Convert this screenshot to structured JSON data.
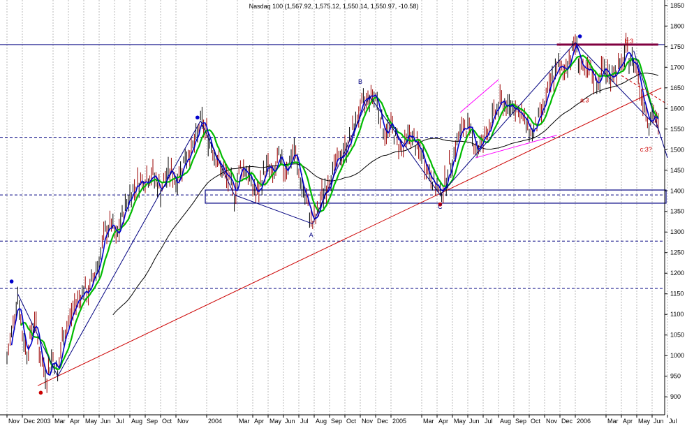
{
  "chart_data": {
    "type": "line",
    "title": "Nasdaq 100 (1,567.92, 1,575.12, 1,550.14, 1,550.97, -10.58)",
    "xlabel": "",
    "ylabel": "",
    "ylim": [
      880,
      1870
    ],
    "y_ticks": [
      900,
      950,
      1000,
      1050,
      1100,
      1150,
      1200,
      1250,
      1300,
      1350,
      1400,
      1450,
      1500,
      1550,
      1600,
      1650,
      1700,
      1750,
      1800,
      1850
    ],
    "x_ticks": [
      {
        "t": 0.0,
        "label": "Nov"
      },
      {
        "t": 1.0,
        "label": "Dec 2003"
      },
      {
        "t": 3.0,
        "label": "Mar"
      },
      {
        "t": 4.0,
        "label": "Apr"
      },
      {
        "t": 5.0,
        "label": "May"
      },
      {
        "t": 6.0,
        "label": "Jun"
      },
      {
        "t": 7.0,
        "label": "Jul"
      },
      {
        "t": 8.0,
        "label": "Aug"
      },
      {
        "t": 9.0,
        "label": "Sep"
      },
      {
        "t": 10.0,
        "label": "Oct"
      },
      {
        "t": 11.0,
        "label": "Nov"
      },
      {
        "t": 13.0,
        "label": "2004"
      },
      {
        "t": 15.0,
        "label": "Mar"
      },
      {
        "t": 16.0,
        "label": "Apr"
      },
      {
        "t": 17.0,
        "label": "May"
      },
      {
        "t": 18.0,
        "label": "Jun"
      },
      {
        "t": 19.0,
        "label": "Jul"
      },
      {
        "t": 20.0,
        "label": "Aug"
      },
      {
        "t": 21.0,
        "label": "Sep"
      },
      {
        "t": 22.0,
        "label": "Oct"
      },
      {
        "t": 23.0,
        "label": "Nov"
      },
      {
        "t": 24.0,
        "label": "Dec"
      },
      {
        "t": 25.0,
        "label": "2005"
      },
      {
        "t": 27.0,
        "label": "Mar"
      },
      {
        "t": 28.0,
        "label": "Apr"
      },
      {
        "t": 29.0,
        "label": "May"
      },
      {
        "t": 30.0,
        "label": "Jun"
      },
      {
        "t": 31.0,
        "label": "Jul"
      },
      {
        "t": 32.0,
        "label": "Aug"
      },
      {
        "t": 33.0,
        "label": "Sep"
      },
      {
        "t": 34.0,
        "label": "Oct"
      },
      {
        "t": 35.0,
        "label": "Nov"
      },
      {
        "t": 36.0,
        "label": "Dec"
      },
      {
        "t": 37.0,
        "label": "2006"
      },
      {
        "t": 39.0,
        "label": "Mar"
      },
      {
        "t": 40.0,
        "label": "Apr"
      },
      {
        "t": 41.0,
        "label": "May"
      },
      {
        "t": 42.0,
        "label": "Jun"
      },
      {
        "t": 43.0,
        "label": "Jul"
      }
    ],
    "price_path": [
      [
        0.0,
        990
      ],
      [
        0.4,
        1080
      ],
      [
        0.7,
        1150
      ],
      [
        1.0,
        1050
      ],
      [
        1.3,
        1010
      ],
      [
        1.8,
        1090
      ],
      [
        2.2,
        990
      ],
      [
        2.6,
        950
      ],
      [
        3.0,
        1000
      ],
      [
        3.3,
        950
      ],
      [
        3.6,
        1040
      ],
      [
        4.0,
        1080
      ],
      [
        4.5,
        1130
      ],
      [
        5.0,
        1160
      ],
      [
        5.3,
        1150
      ],
      [
        5.7,
        1200
      ],
      [
        6.0,
        1230
      ],
      [
        6.4,
        1300
      ],
      [
        6.8,
        1320
      ],
      [
        7.1,
        1280
      ],
      [
        7.6,
        1350
      ],
      [
        8.0,
        1390
      ],
      [
        8.5,
        1420
      ],
      [
        9.0,
        1430
      ],
      [
        9.5,
        1440
      ],
      [
        10.0,
        1400
      ],
      [
        10.3,
        1430
      ],
      [
        10.7,
        1450
      ],
      [
        11.0,
        1420
      ],
      [
        11.3,
        1450
      ],
      [
        11.6,
        1480
      ],
      [
        12.0,
        1500
      ],
      [
        12.3,
        1520
      ],
      [
        12.6,
        1570
      ],
      [
        13.0,
        1540
      ],
      [
        13.5,
        1490
      ],
      [
        14.0,
        1450
      ],
      [
        14.5,
        1420
      ],
      [
        14.8,
        1390
      ],
      [
        15.2,
        1460
      ],
      [
        15.6,
        1450
      ],
      [
        16.0,
        1410
      ],
      [
        16.3,
        1390
      ],
      [
        16.7,
        1440
      ],
      [
        17.0,
        1460
      ],
      [
        17.3,
        1430
      ],
      [
        17.7,
        1480
      ],
      [
        18.0,
        1450
      ],
      [
        18.4,
        1470
      ],
      [
        18.7,
        1500
      ],
      [
        19.0,
        1440
      ],
      [
        19.3,
        1400
      ],
      [
        19.6,
        1360
      ],
      [
        19.9,
        1320
      ],
      [
        20.2,
        1340
      ],
      [
        20.5,
        1390
      ],
      [
        20.8,
        1410
      ],
      [
        21.1,
        1440
      ],
      [
        21.5,
        1470
      ],
      [
        22.0,
        1500
      ],
      [
        22.4,
        1530
      ],
      [
        22.8,
        1580
      ],
      [
        23.2,
        1610
      ],
      [
        23.6,
        1630
      ],
      [
        24.0,
        1630
      ],
      [
        24.3,
        1580
      ],
      [
        24.6,
        1540
      ],
      [
        25.0,
        1560
      ],
      [
        25.4,
        1520
      ],
      [
        25.8,
        1500
      ],
      [
        26.2,
        1540
      ],
      [
        26.6,
        1510
      ],
      [
        27.0,
        1490
      ],
      [
        27.4,
        1450
      ],
      [
        27.8,
        1420
      ],
      [
        28.2,
        1390
      ],
      [
        28.6,
        1430
      ],
      [
        29.0,
        1480
      ],
      [
        29.4,
        1530
      ],
      [
        29.8,
        1560
      ],
      [
        30.2,
        1540
      ],
      [
        30.6,
        1500
      ],
      [
        31.0,
        1520
      ],
      [
        31.4,
        1560
      ],
      [
        31.8,
        1590
      ],
      [
        32.2,
        1620
      ],
      [
        32.6,
        1600
      ],
      [
        33.0,
        1610
      ],
      [
        33.4,
        1590
      ],
      [
        33.8,
        1560
      ],
      [
        34.2,
        1540
      ],
      [
        34.6,
        1570
      ],
      [
        35.0,
        1610
      ],
      [
        35.4,
        1660
      ],
      [
        35.8,
        1700
      ],
      [
        36.2,
        1690
      ],
      [
        36.6,
        1720
      ],
      [
        37.0,
        1760
      ],
      [
        37.3,
        1710
      ],
      [
        37.6,
        1680
      ],
      [
        38.0,
        1690
      ],
      [
        38.4,
        1660
      ],
      [
        38.8,
        1700
      ],
      [
        39.2,
        1680
      ],
      [
        39.6,
        1690
      ],
      [
        40.0,
        1700
      ],
      [
        40.3,
        1740
      ],
      [
        40.6,
        1720
      ],
      [
        41.0,
        1700
      ],
      [
        41.2,
        1650
      ],
      [
        41.5,
        1610
      ],
      [
        41.8,
        1570
      ],
      [
        42.1,
        1590
      ],
      [
        42.4,
        1551
      ]
    ],
    "horizontal_lines": [
      {
        "y": 1755,
        "color": "#000080",
        "style": "solid"
      },
      {
        "y": 1530,
        "color": "#000080",
        "style": "dashed"
      },
      {
        "y": 1390,
        "color": "#000080",
        "style": "dashed"
      },
      {
        "y": 1278,
        "color": "#000080",
        "style": "dashed"
      },
      {
        "y": 1163,
        "color": "#000080",
        "style": "dashed"
      }
    ],
    "resistance_segment": {
      "x1": 35.8,
      "x2": 42.4,
      "y": 1755,
      "color": "#800040"
    },
    "support_box": {
      "x1": 13.0,
      "x2": 43.0,
      "y_low": 1370,
      "y_high": 1402,
      "color": "#000080"
    },
    "long_trend_line": {
      "points": [
        [
          2.0,
          927
        ],
        [
          42.6,
          1650
        ]
      ],
      "color": "#cc0000"
    },
    "annotations": [
      {
        "text": "A",
        "t": 19.8,
        "y": 1288,
        "color": "#000080"
      },
      {
        "text": "B",
        "t": 23.0,
        "y": 1660,
        "color": "#000080"
      },
      {
        "text": "C",
        "t": 28.2,
        "y": 1356,
        "color": "#000080"
      },
      {
        "text": "b:3",
        "t": 40.5,
        "y": 1758,
        "color": "#cc0000"
      },
      {
        "text": "a:3",
        "t": 37.6,
        "y": 1615,
        "color": "#cc0000"
      },
      {
        "text": "c:3?",
        "t": 41.6,
        "y": 1495,
        "color": "#cc0000"
      }
    ],
    "markers": [
      {
        "t": 0.3,
        "y": 1180,
        "color": "#0000cc"
      },
      {
        "t": 2.2,
        "y": 910,
        "color": "#cc0000"
      },
      {
        "t": 12.4,
        "y": 1578,
        "color": "#0000cc"
      },
      {
        "t": 28.2,
        "y": 1367,
        "color": "#cc0000"
      },
      {
        "t": 37.3,
        "y": 1775,
        "color": "#0000cc"
      }
    ],
    "series_colors": {
      "bars": "#990000",
      "bars_alt": "#000000",
      "ma_fast": "#0000cc",
      "ma_mid": "#00bb00",
      "ma_slow": "#000000",
      "grid": "#b8b8b8",
      "trendline": "#cc0000",
      "channel": "#ff00ff"
    },
    "grid": true
  }
}
